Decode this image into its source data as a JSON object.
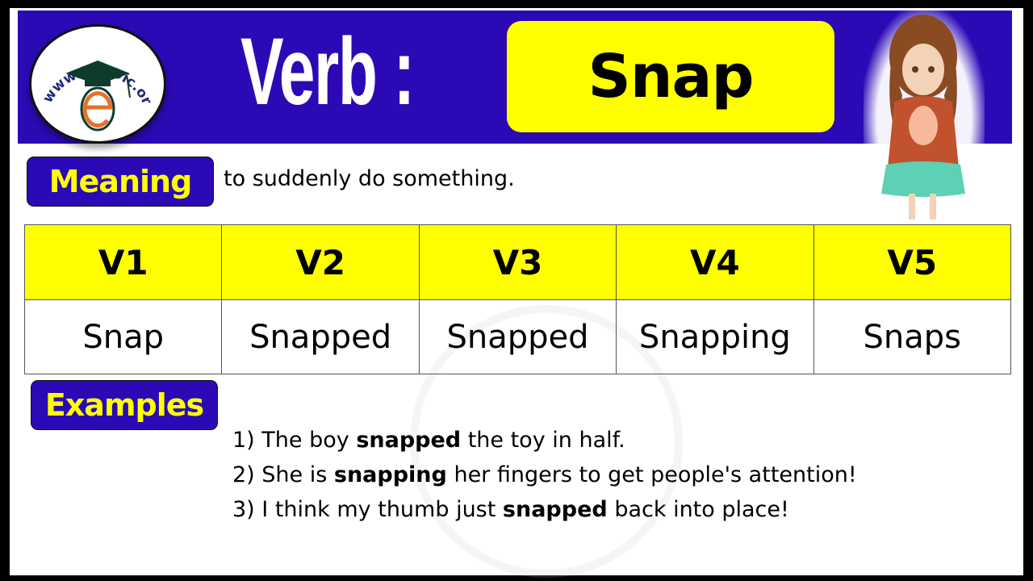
{
  "banner": {
    "logo_text": "www.EngDic.org",
    "title_label": "Verb :",
    "word": "Snap"
  },
  "meaning": {
    "label": "Meaning",
    "text": "to suddenly  do something."
  },
  "forms_table": {
    "headers": [
      "V1",
      "V2",
      "V3",
      "V4",
      "V5"
    ],
    "values": [
      "Snap",
      "Snapped",
      "Snapped",
      "Snapping",
      "Snaps"
    ]
  },
  "examples": {
    "label": "Examples",
    "items": [
      {
        "prefix": "1) The boy ",
        "bold": "snapped",
        "suffix": " the toy in half."
      },
      {
        "prefix": "2) She is ",
        "bold": "snapping",
        "suffix": " her fingers to get people's attention!"
      },
      {
        "prefix": "3) I think my thumb just ",
        "bold": "snapped",
        "suffix": " back into place!"
      }
    ]
  },
  "colors": {
    "banner_blue": "#2b0ab5",
    "highlight_yellow": "#ffff00",
    "logo_orange": "#e8702a",
    "logo_green": "#0d3b2e"
  }
}
